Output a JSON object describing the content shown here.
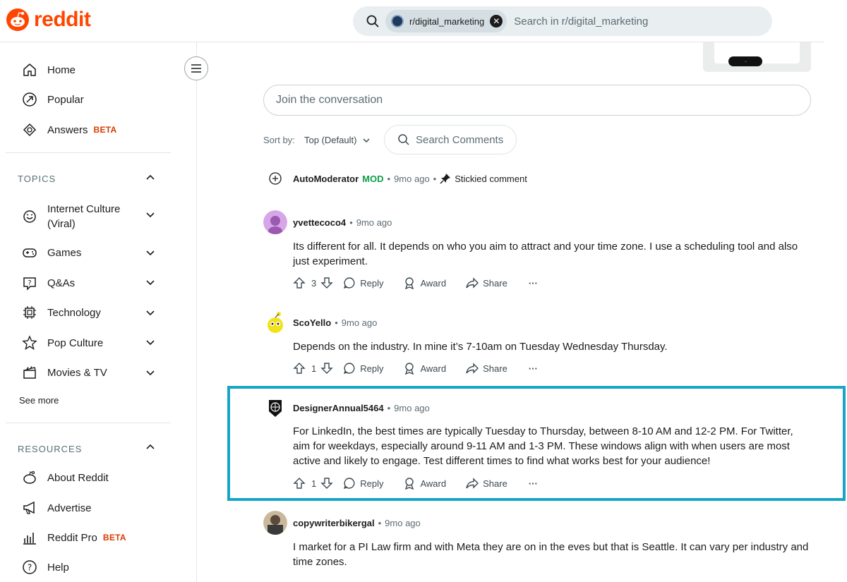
{
  "header": {
    "brand": "reddit",
    "search_chip": "r/digital_marketing",
    "search_placeholder": "Search in r/digital_marketing"
  },
  "sidebar": {
    "main_items": [
      {
        "label": "Home",
        "icon": "home-icon"
      },
      {
        "label": "Popular",
        "icon": "popular-icon"
      },
      {
        "label": "Answers",
        "icon": "answers-icon",
        "badge": "BETA"
      }
    ],
    "topics_title": "TOPICS",
    "topics": [
      {
        "label": "Internet Culture (Viral)",
        "icon": "smile-icon"
      },
      {
        "label": "Games",
        "icon": "gamepad-icon"
      },
      {
        "label": "Q&As",
        "icon": "question-bubble-icon"
      },
      {
        "label": "Technology",
        "icon": "chip-icon"
      },
      {
        "label": "Pop Culture",
        "icon": "star-icon"
      },
      {
        "label": "Movies & TV",
        "icon": "clapperboard-icon"
      }
    ],
    "see_more": "See more",
    "resources_title": "RESOURCES",
    "resources": [
      {
        "label": "About Reddit",
        "icon": "reddit-icon"
      },
      {
        "label": "Advertise",
        "icon": "megaphone-icon"
      },
      {
        "label": "Reddit Pro",
        "icon": "bar-chart-icon",
        "badge": "BETA"
      },
      {
        "label": "Help",
        "icon": "help-icon"
      }
    ]
  },
  "main": {
    "join_placeholder": "Join the conversation",
    "sort_label": "Sort by:",
    "sort_value": "Top (Default)",
    "search_comments": "Search Comments",
    "sticky": {
      "user": "AutoModerator",
      "mod": "MOD",
      "time": "9mo ago",
      "stickied": "Stickied comment"
    },
    "comments": [
      {
        "user": "yvettecoco4",
        "time": "9mo ago",
        "body": "Its different for all. It depends on who you aim to attract and your time zone. I use a scheduling tool and also just experiment.",
        "votes": "3"
      },
      {
        "user": "ScoYello",
        "time": "9mo ago",
        "body": "Depends on the industry. In mine it’s 7-10am on Tuesday Wednesday Thursday.",
        "votes": "1"
      },
      {
        "user": "DesignerAnnual5464",
        "time": "9mo ago",
        "body": "For LinkedIn, the best times are typically Tuesday to Thursday, between 8-10 AM and 12-2 PM. For Twitter, aim for weekdays, especially around 9-11 AM and 1-3 PM. These windows align with when users are most active and likely to engage. Test different times to find what works best for your audience!",
        "votes": "1"
      },
      {
        "user": "copywriterbikergal",
        "time": "9mo ago",
        "body": "I market for a PI Law firm and with Meta they are on in the eves but that is Seattle. It can vary per industry and time zones."
      }
    ],
    "actions": {
      "reply": "Reply",
      "award": "Award",
      "share": "Share",
      "more": "···"
    },
    "separator": "•"
  },
  "colors": {
    "brand": "#ff4500",
    "mod": "#0c9f48",
    "highlight": "#16a5c8",
    "beta": "#d93900"
  }
}
